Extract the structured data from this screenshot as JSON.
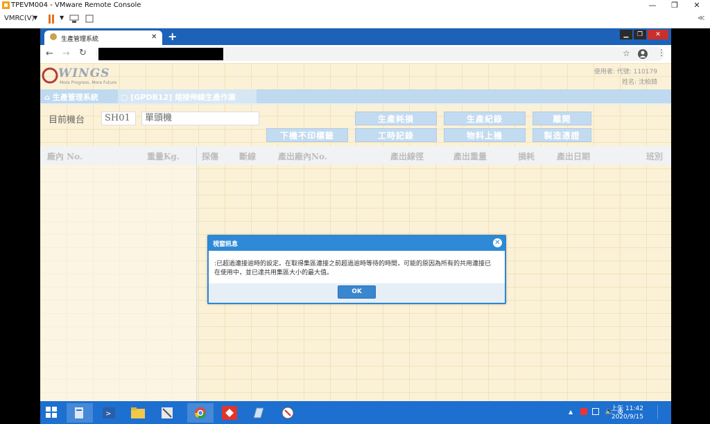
{
  "vm": {
    "title": "TPEVM004 - VMware Remote Console",
    "menu_label": "VMRC(V)",
    "collapse_label": "≪"
  },
  "browser": {
    "tab_title": "生產管理系統",
    "new_tab": "+"
  },
  "app": {
    "logo_text": "WINGS",
    "logo_slogan": "More Progress, More Future",
    "user_line1": "使用者:  代號: 110179",
    "user_line2": "姓名: 沈柏錡",
    "nav_home": "生產管理系統",
    "nav_page": "[GPDB12] 熔接伸線生產作業",
    "machine_label": "目前機台",
    "machine_code": "SH01",
    "machine_name": "單頭機",
    "buttons": {
      "production_loss": "生產耗損",
      "production_record": "生產紀錄",
      "leave": "離開",
      "no_print_label": "下機不印標籤",
      "work_record": "工時記錄",
      "material_load": "物料上機",
      "manufacturing_voucher": "製造憑證"
    },
    "columns": {
      "factory_no": "廠內 No.",
      "weight": "重量Kg.",
      "probe_injury": "探傷",
      "broken_wire": "斷線",
      "output_factory_no": "產出廠內No.",
      "output_diameter": "產出線徑",
      "output_weight": "產出重量",
      "loss": "損耗",
      "output_date": "產出日期",
      "shift": "班別"
    }
  },
  "dialog": {
    "title": "視窗訊息",
    "message": ":已超過連接逾時的設定。在取得集區連接之前超過逾時等待的時間，可能的原因為所有的共用連接已在使用中，並已達共用集區大小的最大值。",
    "ok_label": "OK"
  },
  "taskbar": {
    "time": "上午 11:42",
    "date": "2020/9/15"
  },
  "colors": {
    "chrome_blue": "#1c62b9",
    "taskbar_blue": "#1d6fd0",
    "dialog_blue": "#2e8ad6",
    "button_blue": "#c3dbf0",
    "app_background": "#fbf1d7"
  }
}
